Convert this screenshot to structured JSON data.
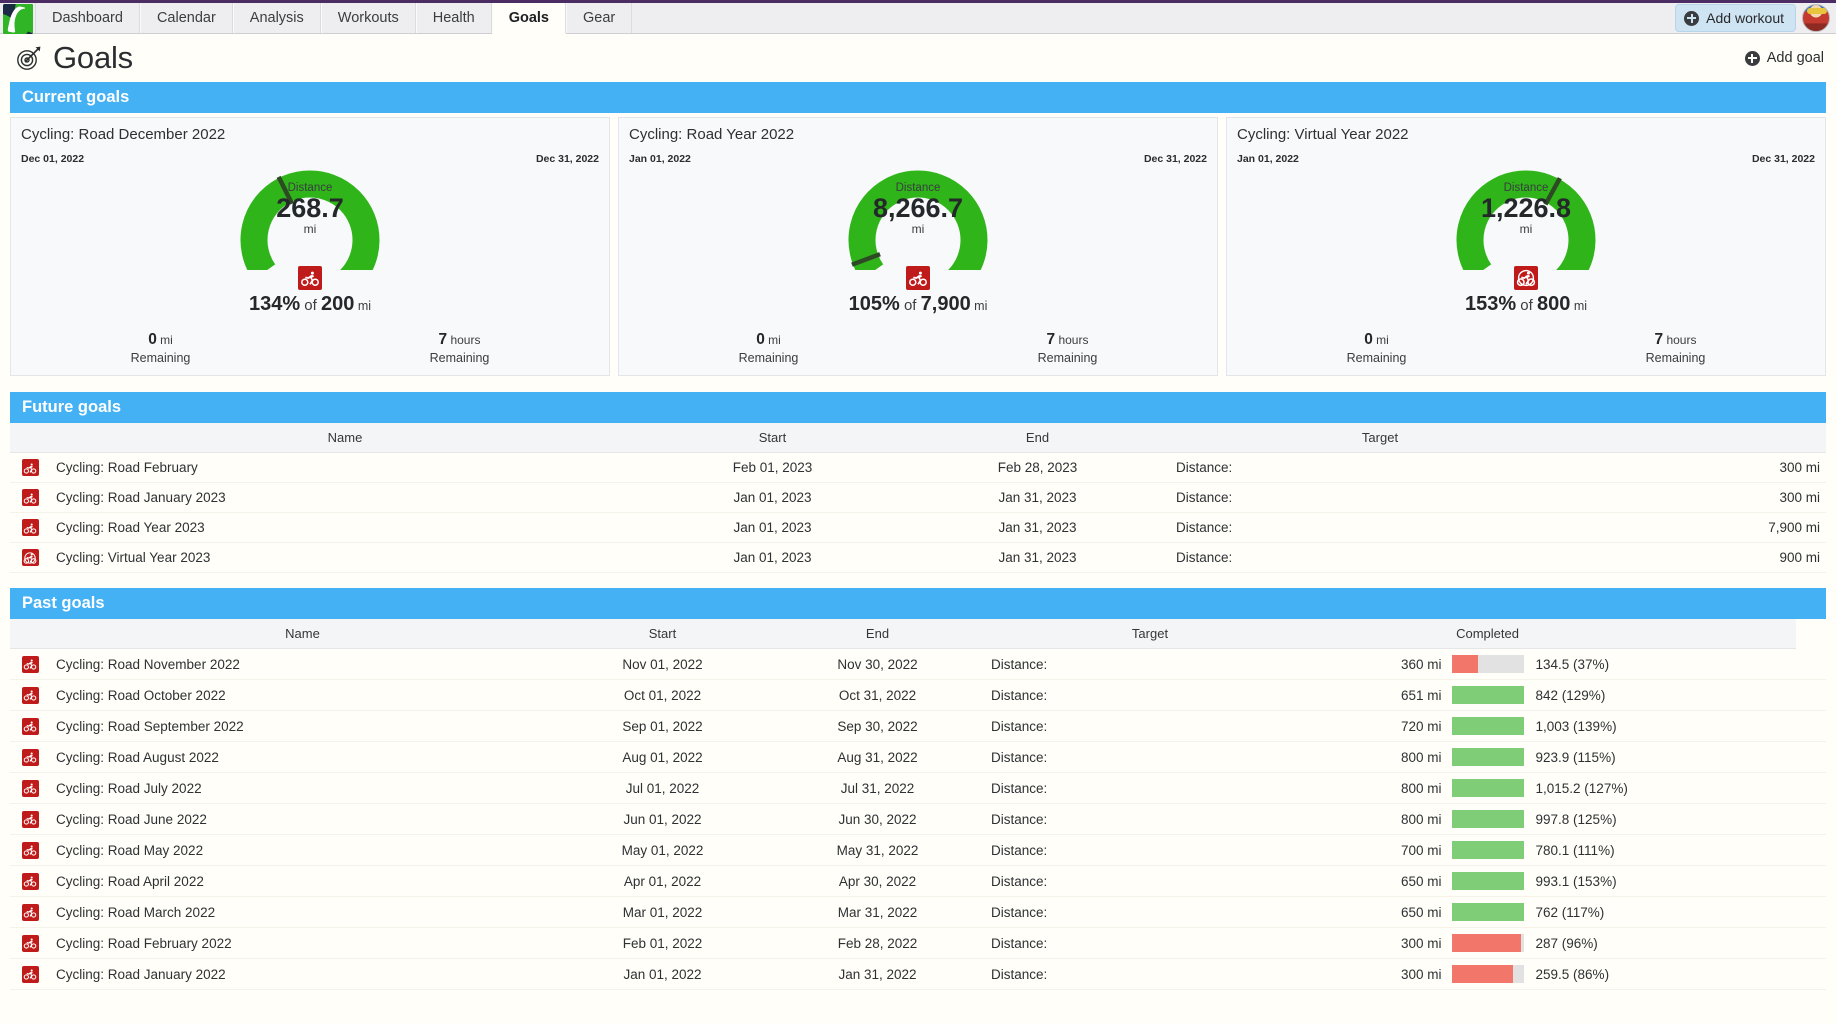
{
  "topbar": {
    "logo_name": "app-logo",
    "tabs": [
      {
        "label": "Dashboard",
        "active": false
      },
      {
        "label": "Calendar",
        "active": false
      },
      {
        "label": "Analysis",
        "active": false
      },
      {
        "label": "Workouts",
        "active": false
      },
      {
        "label": "Health",
        "active": false
      },
      {
        "label": "Goals",
        "active": true
      },
      {
        "label": "Gear",
        "active": false
      }
    ],
    "add_workout_label": "Add workout",
    "accent_purple": "#4b2c63"
  },
  "page": {
    "title": "Goals",
    "add_goal_label": "Add goal",
    "section_accent": "#45b1f5"
  },
  "current_goals": {
    "heading": "Current goals",
    "cards": [
      {
        "title": "Cycling: Road December 2022",
        "start": "Dec 01, 2022",
        "end": "Dec 31, 2022",
        "metric_label": "Distance",
        "value": "268.7",
        "unit": "mi",
        "percent": "134%",
        "of_word": "of",
        "target": "200",
        "target_unit": "mi",
        "percent_num": 134,
        "sport_icon": "cycling-road-icon",
        "remaining_distance": "0",
        "remaining_distance_unit": "mi",
        "remaining_distance_sub": "Remaining",
        "remaining_time": "7",
        "remaining_time_unit": "hours",
        "remaining_time_sub": "Remaining"
      },
      {
        "title": "Cycling: Road Year 2022",
        "start": "Jan 01, 2022",
        "end": "Dec 31, 2022",
        "metric_label": "Distance",
        "value": "8,266.7",
        "unit": "mi",
        "percent": "105%",
        "of_word": "of",
        "target": "7,900",
        "target_unit": "mi",
        "percent_num": 105,
        "sport_icon": "cycling-road-icon",
        "remaining_distance": "0",
        "remaining_distance_unit": "mi",
        "remaining_distance_sub": "Remaining",
        "remaining_time": "7",
        "remaining_time_unit": "hours",
        "remaining_time_sub": "Remaining"
      },
      {
        "title": "Cycling: Virtual Year 2022",
        "start": "Jan 01, 2022",
        "end": "Dec 31, 2022",
        "metric_label": "Distance",
        "value": "1,226.8",
        "unit": "mi",
        "percent": "153%",
        "of_word": "of",
        "target": "800",
        "target_unit": "mi",
        "percent_num": 153,
        "sport_icon": "cycling-virtual-icon",
        "remaining_distance": "0",
        "remaining_distance_unit": "mi",
        "remaining_distance_sub": "Remaining",
        "remaining_time": "7",
        "remaining_time_unit": "hours",
        "remaining_time_sub": "Remaining"
      }
    ]
  },
  "future_goals": {
    "heading": "Future goals",
    "columns": [
      "",
      "Name",
      "Start",
      "End",
      "Target",
      ""
    ],
    "rows": [
      {
        "icon": "cycling-road-icon",
        "name": "Cycling: Road February",
        "start": "Feb 01, 2023",
        "end": "Feb 28, 2023",
        "target_label": "Distance:",
        "target_value": "300 mi"
      },
      {
        "icon": "cycling-road-icon",
        "name": "Cycling: Road January 2023",
        "start": "Jan 01, 2023",
        "end": "Jan 31, 2023",
        "target_label": "Distance:",
        "target_value": "300 mi"
      },
      {
        "icon": "cycling-road-icon",
        "name": "Cycling: Road Year 2023",
        "start": "Jan 01, 2023",
        "end": "Jan 31, 2023",
        "target_label": "Distance:",
        "target_value": "7,900 mi"
      },
      {
        "icon": "cycling-virtual-icon",
        "name": "Cycling: Virtual Year 2023",
        "start": "Jan 01, 2023",
        "end": "Jan 31, 2023",
        "target_label": "Distance:",
        "target_value": "900 mi"
      }
    ]
  },
  "past_goals": {
    "heading": "Past goals",
    "columns": [
      "",
      "Name",
      "Start",
      "End",
      "Target",
      "",
      "Completed",
      ""
    ],
    "rows": [
      {
        "icon": "cycling-road-icon",
        "name": "Cycling: Road November 2022",
        "start": "Nov 01, 2022",
        "end": "Nov 30, 2022",
        "target_label": "Distance:",
        "target_value": "360 mi",
        "percent": 37,
        "result": "134.5 (37%)",
        "over": false
      },
      {
        "icon": "cycling-road-icon",
        "name": "Cycling: Road October 2022",
        "start": "Oct 01, 2022",
        "end": "Oct 31, 2022",
        "target_label": "Distance:",
        "target_value": "651 mi",
        "percent": 129,
        "result": "842 (129%)",
        "over": true
      },
      {
        "icon": "cycling-road-icon",
        "name": "Cycling: Road September 2022",
        "start": "Sep 01, 2022",
        "end": "Sep 30, 2022",
        "target_label": "Distance:",
        "target_value": "720 mi",
        "percent": 139,
        "result": "1,003 (139%)",
        "over": true
      },
      {
        "icon": "cycling-road-icon",
        "name": "Cycling: Road August 2022",
        "start": "Aug 01, 2022",
        "end": "Aug 31, 2022",
        "target_label": "Distance:",
        "target_value": "800 mi",
        "percent": 115,
        "result": "923.9 (115%)",
        "over": true
      },
      {
        "icon": "cycling-road-icon",
        "name": "Cycling: Road July 2022",
        "start": "Jul 01, 2022",
        "end": "Jul 31, 2022",
        "target_label": "Distance:",
        "target_value": "800 mi",
        "percent": 127,
        "result": "1,015.2 (127%)",
        "over": true
      },
      {
        "icon": "cycling-road-icon",
        "name": "Cycling: Road June 2022",
        "start": "Jun 01, 2022",
        "end": "Jun 30, 2022",
        "target_label": "Distance:",
        "target_value": "800 mi",
        "percent": 125,
        "result": "997.8 (125%)",
        "over": true
      },
      {
        "icon": "cycling-road-icon",
        "name": "Cycling: Road May 2022",
        "start": "May 01, 2022",
        "end": "May 31, 2022",
        "target_label": "Distance:",
        "target_value": "700 mi",
        "percent": 111,
        "result": "780.1 (111%)",
        "over": true
      },
      {
        "icon": "cycling-road-icon",
        "name": "Cycling: Road April 2022",
        "start": "Apr 01, 2022",
        "end": "Apr 30, 2022",
        "target_label": "Distance:",
        "target_value": "650 mi",
        "percent": 153,
        "result": "993.1 (153%)",
        "over": true
      },
      {
        "icon": "cycling-road-icon",
        "name": "Cycling: Road March 2022",
        "start": "Mar 01, 2022",
        "end": "Mar 31, 2022",
        "target_label": "Distance:",
        "target_value": "650 mi",
        "percent": 117,
        "result": "762 (117%)",
        "over": true
      },
      {
        "icon": "cycling-road-icon",
        "name": "Cycling: Road February 2022",
        "start": "Feb 01, 2022",
        "end": "Feb 28, 2022",
        "target_label": "Distance:",
        "target_value": "300 mi",
        "percent": 96,
        "result": "287 (96%)",
        "over": false
      },
      {
        "icon": "cycling-road-icon",
        "name": "Cycling: Road January 2022",
        "start": "Jan 01, 2022",
        "end": "Jan 31, 2022",
        "target_label": "Distance:",
        "target_value": "300 mi",
        "percent": 86,
        "result": "259.5 (86%)",
        "over": false
      }
    ]
  },
  "colors": {
    "gauge_green": "#2fb519",
    "needle": "#2e4a25",
    "bar_green": "#7fce77",
    "bar_red": "#f2776a",
    "sport_red": "#c01b1b"
  }
}
